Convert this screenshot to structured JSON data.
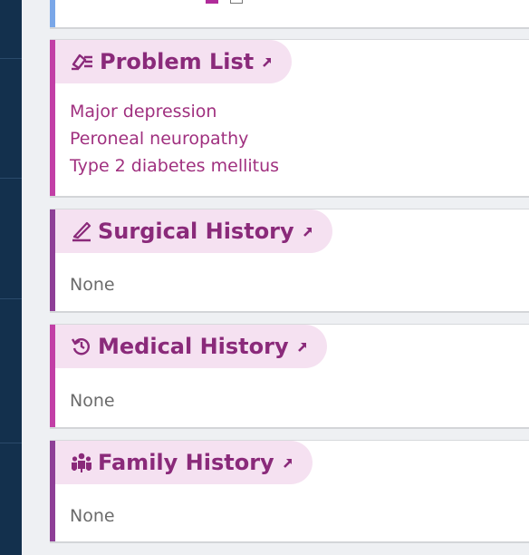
{
  "colors": {
    "sidebar": "#13304d",
    "background": "#eef0f3",
    "title": "#8a2a7a",
    "pill": "#f5e1f1",
    "accent_magenta": "#c23fa6",
    "accent_purple": "#8e3f97",
    "item_text": "#a0307f",
    "none_text": "#6b6b6b"
  },
  "sections": {
    "problem_list": {
      "title": "Problem List",
      "icon": "problem-list-icon",
      "items": [
        "Major depression",
        "Peroneal neuropathy",
        "Type 2 diabetes mellitus"
      ]
    },
    "surgical_history": {
      "title": "Surgical History",
      "icon": "scalpel-icon",
      "empty_text": "None"
    },
    "medical_history": {
      "title": "Medical History",
      "icon": "history-icon",
      "empty_text": "None"
    },
    "family_history": {
      "title": "Family History",
      "icon": "family-icon",
      "empty_text": "None"
    }
  }
}
